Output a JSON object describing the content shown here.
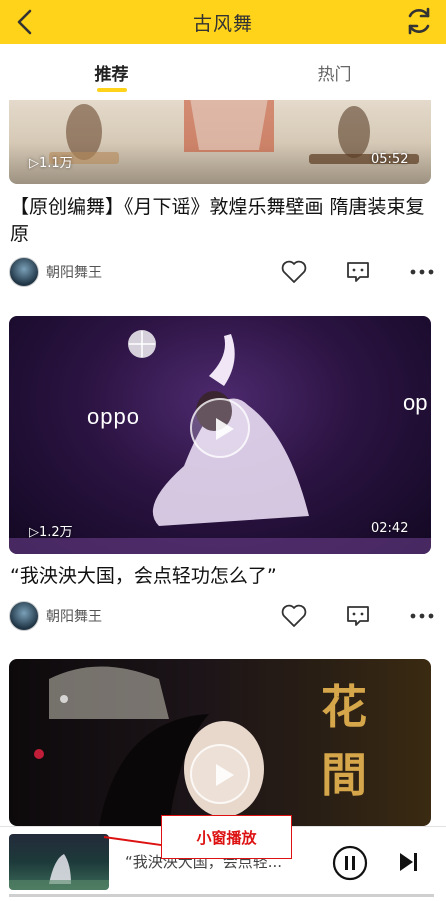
{
  "header": {
    "title": "古风舞",
    "back_icon": "chevron-left-icon",
    "refresh_icon": "refresh-icon",
    "background": "#FFD31A"
  },
  "tabs": [
    {
      "label": "推荐",
      "active": true
    },
    {
      "label": "热门",
      "active": false
    }
  ],
  "feed": [
    {
      "views": "1.1万",
      "duration": "05:52",
      "title": "【原创编舞】《月下谣》敦煌乐舞壁画 隋唐装束复原",
      "author": "朝阳舞王"
    },
    {
      "views": "1.2万",
      "duration": "02:42",
      "brand_watermark": "oppo",
      "title": "“我泱泱大国，会点轻功怎么了”",
      "author": "朝阳舞王"
    },
    {
      "title_art": "花間"
    }
  ],
  "mini_player": {
    "now_playing": "“我泱泱大国，会点轻...",
    "progress": 1.0
  },
  "annotation": {
    "label": "小窗播放",
    "color": "#DD1111"
  }
}
